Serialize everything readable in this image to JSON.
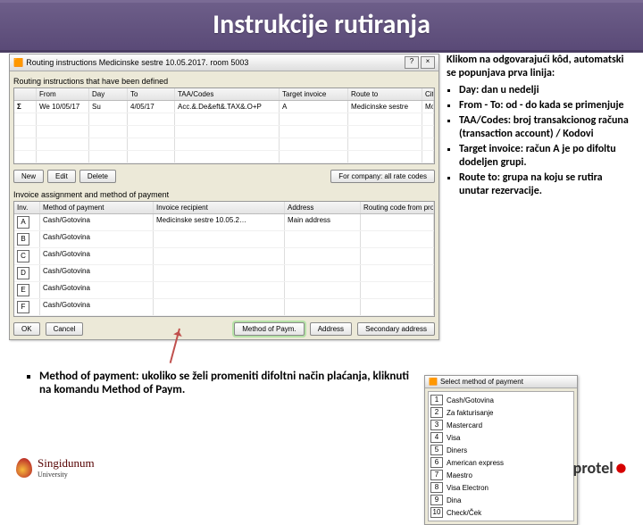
{
  "header": {
    "title": "Instrukcije rutiranja"
  },
  "routing_window": {
    "title": "Routing instructions Medicinske sestre 10.05.2017.   room 5003",
    "section1_label": "Routing instructions that have been defined",
    "cols": [
      "",
      "From",
      "Day",
      "To",
      "TAA/Codes",
      "Target invoice",
      "Route to",
      "City"
    ],
    "row": {
      "c0": "Σ",
      "c1": "We",
      "c2": "10/05/17",
      "c3": "Su",
      "c4": "4/05/17",
      "taa": "Acc.&.De&eft&.TAX&.O+P",
      "target": "A",
      "route": "Medicinske sestre",
      "city": "MoTuWeThFrSaSu"
    },
    "buttons": {
      "new": "New",
      "edit": "Edit",
      "delete": "Delete",
      "ok_all": "For company: all rate codes"
    },
    "section2_label": "Invoice assignment and method of payment",
    "cols2": [
      "Inv.",
      "Method of payment",
      "Invoice recipient",
      "Address",
      "Routing code from profile"
    ],
    "rows2": [
      [
        "A",
        "Cash/Gotovina",
        "Medicinske sestre 10.05.2…",
        "Main address",
        ""
      ],
      [
        "B",
        "Cash/Gotovina",
        "",
        "",
        ""
      ],
      [
        "C",
        "Cash/Gotovina",
        "",
        "",
        ""
      ],
      [
        "D",
        "Cash/Gotovina",
        "",
        "",
        ""
      ],
      [
        "E",
        "Cash/Gotovina",
        "",
        "",
        ""
      ],
      [
        "F",
        "Cash/Gotovina",
        "",
        "",
        ""
      ]
    ],
    "bottom": {
      "ok": "OK",
      "cancel": "Cancel",
      "method": "Method of Paym.",
      "address": "Address",
      "secondary": "Secondary address"
    }
  },
  "right": {
    "lead": "Klikom na odgovarajući kôd, automatski se popunjava prva linija:",
    "items": [
      "Day: dan u nedelji",
      "From - To: od - do kada se primenjuje",
      "TAA/Codes: broj transakcionog računa (transaction account) / Kodovi",
      "Target invoice: račun A je po difoltu dodeljen grupi.",
      "Route to: grupa na koju se rutira unutar rezervacije."
    ]
  },
  "note": "Method of payment: ukoliko se želi promeniti difoltni način plaćanja, kliknuti na komandu Method of Paym.",
  "payment": {
    "title": "Select method of payment",
    "items": [
      [
        "1",
        "Cash/Gotovina"
      ],
      [
        "2",
        "Za fakturisanje"
      ],
      [
        "3",
        "Mastercard"
      ],
      [
        "4",
        "Visa"
      ],
      [
        "5",
        "Diners"
      ],
      [
        "6",
        "American express"
      ],
      [
        "7",
        "Maestro"
      ],
      [
        "8",
        "Visa Electron"
      ],
      [
        "9",
        "Dina"
      ],
      [
        "10",
        "Check/Ček"
      ]
    ]
  },
  "footer": {
    "uni": "Singidunum",
    "sub": "University",
    "brand": "protel"
  }
}
